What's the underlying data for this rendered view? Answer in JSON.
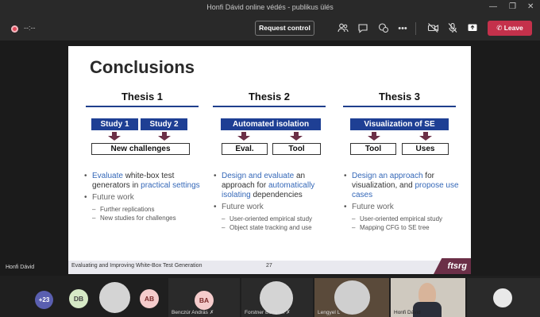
{
  "window": {
    "title": "Honfi Dávid online védés - publikus ülés"
  },
  "toolbar": {
    "timer": "--:--",
    "request_control": "Request control",
    "leave": "Leave"
  },
  "slide": {
    "title": "Conclusions",
    "theses": [
      {
        "heading": "Thesis 1",
        "blue_boxes": [
          "Study 1",
          "Study 2"
        ],
        "outputs": [
          "New challenges"
        ],
        "bullets": [
          {
            "pre": "",
            "hl1": "Evaluate",
            "mid": " white-box test generators in ",
            "hl2": "practical settings",
            "post": ""
          }
        ],
        "future": "Future work",
        "subs": [
          "Further replications",
          "New studies for challenges"
        ]
      },
      {
        "heading": "Thesis 2",
        "blue_boxes": [
          "Automated isolation"
        ],
        "outputs": [
          "Eval.",
          "Tool"
        ],
        "bullets": [
          {
            "pre": "",
            "hl1": "Design and evaluate",
            "mid": " an approach for ",
            "hl2": "automatically isolating",
            "post": " dependencies"
          }
        ],
        "future": "Future work",
        "subs": [
          "User-oriented empirical study",
          "Object state tracking and use"
        ]
      },
      {
        "heading": "Thesis 3",
        "blue_boxes": [
          "Visualization of SE"
        ],
        "outputs": [
          "Tool",
          "Uses"
        ],
        "bullets": [
          {
            "pre": "",
            "hl1": "Design an approach",
            "mid": " for visualization, and ",
            "hl2": "propose use cases",
            "post": ""
          }
        ],
        "future": "Future work",
        "subs": [
          "User-oriented empirical study",
          "Mapping CFG to SE tree"
        ]
      }
    ],
    "footer_text": "Evaluating and Improving White-Box Test Generation",
    "page_number": "27",
    "logo": "ftsrg"
  },
  "presenter_name": "Honfi Dávid",
  "participants": {
    "overflow": "+23",
    "avatars": [
      "DB",
      "AB",
      "BA"
    ],
    "names": [
      "Benczúr András",
      "Forstner Bertalan",
      "Lengyel L",
      "Honfi Dávid"
    ]
  },
  "colors": {
    "accent_blue": "#1e3f94",
    "arrow_maroon": "#6b2f47",
    "leave_red": "#c4314b"
  },
  "icons": [
    "participants-icon",
    "chat-icon",
    "reactions-icon",
    "more-icon",
    "camera-off-icon",
    "mic-off-icon",
    "share-icon",
    "hangup-icon"
  ]
}
